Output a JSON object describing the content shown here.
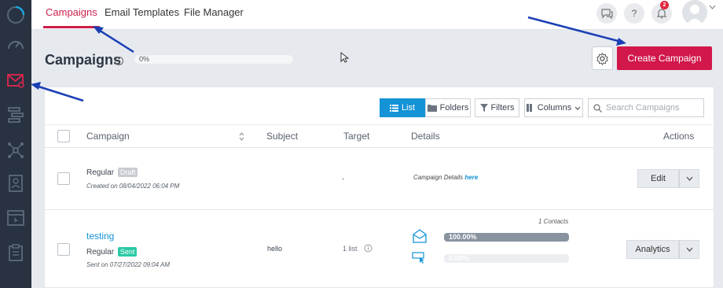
{
  "topbar": {
    "tabs": [
      {
        "label": "Campaigns",
        "active": true
      },
      {
        "label": "Email Templates",
        "active": false
      },
      {
        "label": "File Manager",
        "active": false
      }
    ],
    "notification_count": "2",
    "help_label": "?"
  },
  "leftnav": {
    "icons": [
      "loading-ring-icon",
      "speedometer-icon",
      "envelope-campaigns-icon",
      "hierarchy-icon",
      "network-icon",
      "contact-form-icon",
      "web-page-icon",
      "clipboard-icon"
    ],
    "active": "envelope-campaigns-icon"
  },
  "header": {
    "title": "Campaigns",
    "info": "i",
    "progress_text": "0%",
    "create_label": "Create Campaign"
  },
  "toolbar": {
    "list_label": "List",
    "folders_label": "Folders",
    "filters_label": "Filters",
    "columns_label": "Columns",
    "search_placeholder": "Search Campaigns"
  },
  "table": {
    "headers": {
      "campaign": "Campaign",
      "subject": "Subject",
      "target": "Target",
      "details": "Details",
      "actions": "Actions"
    },
    "rows": [
      {
        "name": "",
        "type": "Regular",
        "status": "Draft",
        "meta": "Created on 08/04/2022 06:04 PM",
        "subject": "",
        "target": "-",
        "details_text": "Campaign Details ",
        "details_link": "here",
        "action": "Edit"
      },
      {
        "name": "testing",
        "type": "Regular",
        "status": "Sent",
        "meta": "Sent on 07/27/2022 09:04 AM",
        "subject": "hello",
        "target": "1 list",
        "contacts": "1 Contacts",
        "open_rate_text": "100.00%",
        "open_rate": 1.0,
        "click_rate_text": "0.00%",
        "click_rate": 0.0,
        "action": "Analytics"
      }
    ]
  },
  "colors": {
    "accent": "#d2174a",
    "nav_bg": "#283240",
    "list_active": "#1493d6",
    "sent_badge": "#2bc9a5",
    "annotation_arrow": "#1a3fb5"
  }
}
